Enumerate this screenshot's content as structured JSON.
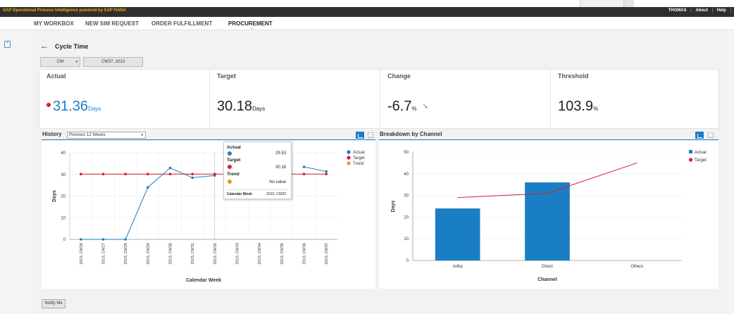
{
  "app": {
    "title": "SAP Operational Process Intelligence powered by SAP HANA",
    "user": "THOMAS",
    "about": "About",
    "help": "Help",
    "separator": "|"
  },
  "nav": {
    "tabs": [
      {
        "label": "MY WORKBOX"
      },
      {
        "label": "NEW SIM REQUEST"
      },
      {
        "label": "ORDER FULFILLMENT"
      },
      {
        "label": "PROCUREMENT",
        "active": true
      }
    ]
  },
  "page": {
    "title": "Cycle Time",
    "period_select": "CW",
    "period_value": "CW37, 2013"
  },
  "kpis": [
    {
      "label": "Actual",
      "value": "31.36",
      "unit": "Days",
      "status_color": "#d32030",
      "value_color": "#1a7ec4"
    },
    {
      "label": "Target",
      "value": "30.18",
      "unit": "Days"
    },
    {
      "label": "Change",
      "value": "-6.7",
      "unit": "%",
      "trend": "down-right-arrow-icon"
    },
    {
      "label": "Threshold",
      "value": "103.9",
      "unit": "%"
    }
  ],
  "history": {
    "title": "History",
    "range_select": "Previous 12 Weeks"
  },
  "breakdown": {
    "title": "Breakdown by Channel"
  },
  "tooltip": {
    "actual_label": "Actual",
    "actual_value": "29.53",
    "target_label": "Target",
    "target_value": "30.18",
    "trend_label": "Trend",
    "trend_value": "No value",
    "week_label": "Calendar Week",
    "week_value": "2013, CW32"
  },
  "notify_button": "Notify Me",
  "colors": {
    "actual": "#1a7ec4",
    "target": "#d32030",
    "trend": "#e0a21a",
    "header_bg": "#2f2f2f",
    "brand": "#f0ab00"
  },
  "chart_data": [
    {
      "type": "line",
      "xlabel": "Calendar Week",
      "ylabel": "Days",
      "ylim": [
        0,
        40
      ],
      "yticks": [
        0,
        10,
        20,
        30,
        40
      ],
      "categories": [
        "2013, CW26",
        "2013, CW27",
        "2013, CW28",
        "2013, CW29",
        "2013, CW30",
        "2013, CW31",
        "2013, CW32",
        "2013, CW33",
        "2013, CW34",
        "2013, CW35",
        "2013, CW36",
        "2013, CW37"
      ],
      "series": [
        {
          "name": "Actual",
          "color": "#1a7ec4",
          "values": [
            0,
            0,
            0,
            24,
            33,
            28.5,
            29.53,
            null,
            null,
            null,
            33.5,
            31.36
          ]
        },
        {
          "name": "Target",
          "color": "#d32030",
          "values": [
            30.18,
            30.18,
            30.18,
            30.18,
            30.18,
            30.18,
            30.18,
            30.18,
            30.18,
            30.18,
            30.18,
            30.18
          ]
        },
        {
          "name": "Trend",
          "color": "#e0a21a",
          "values": []
        }
      ],
      "grid": true,
      "legend": "top-right"
    },
    {
      "type": "bar",
      "xlabel": "Channel",
      "ylabel": "Days",
      "ylim": [
        0,
        50
      ],
      "yticks": [
        0,
        10,
        20,
        30,
        40,
        50
      ],
      "categories": [
        "Ariba",
        "Direct",
        "Others"
      ],
      "series": [
        {
          "name": "Actual",
          "color": "#1a7ec4",
          "kind": "bar",
          "values": [
            24,
            36,
            null
          ]
        },
        {
          "name": "Target",
          "color": "#d32030",
          "kind": "line",
          "values": [
            29,
            31,
            45
          ]
        }
      ],
      "grid": true,
      "legend": "top-right"
    }
  ]
}
